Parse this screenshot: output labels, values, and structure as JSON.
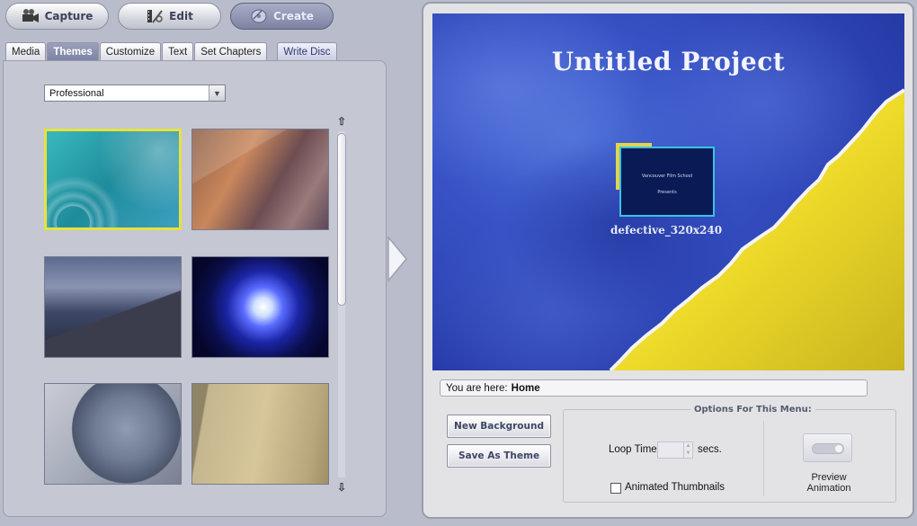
{
  "modes": {
    "capture": "Capture",
    "edit": "Edit",
    "create": "Create"
  },
  "tabs": [
    "Media",
    "Themes",
    "Customize",
    "Text",
    "Set Chapters"
  ],
  "active_tab": "Themes",
  "write_disc": "Write Disc",
  "theme_category": "Professional",
  "preview": {
    "title": "Untitled Project",
    "thumb_line1": "Vancouver Film School",
    "thumb_line2": "Presents",
    "caption": "defective_320x240"
  },
  "breadcrumb": {
    "label": "You are here:",
    "location": "Home"
  },
  "buttons": {
    "new_background": "New Background",
    "save_as_theme": "Save As Theme"
  },
  "options": {
    "title": "Options For This Menu:",
    "loop_time_label": "Loop Time",
    "loop_time_unit": "secs.",
    "animated_thumbnails": "Animated Thumbnails",
    "preview_animation_line1": "Preview",
    "preview_animation_line2": "Animation"
  },
  "colors": {
    "selected_border": "#e8e23c",
    "preview_blue": "#2a3fae",
    "preview_yellow": "#f1e22f"
  }
}
